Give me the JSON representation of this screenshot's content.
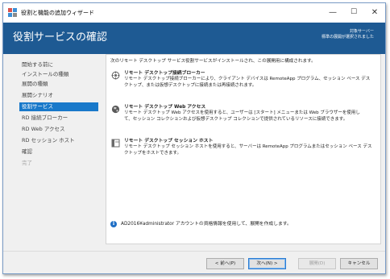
{
  "window": {
    "title": "役割と機能の追加ウィザード",
    "controls": {
      "minimize": "—",
      "maximize": "☐",
      "close": "✕"
    }
  },
  "header": {
    "title": "役割サービスの確認",
    "target_label": "対象サーバー",
    "target_value": "標準の展開が選択されました"
  },
  "nav": {
    "items": [
      {
        "label": "開始する前に",
        "state": "normal"
      },
      {
        "label": "インストールの種類",
        "state": "normal"
      },
      {
        "label": "展開の種類",
        "state": "normal"
      },
      {
        "label": "展開シナリオ",
        "state": "normal"
      },
      {
        "label": "役割サービス",
        "state": "selected"
      },
      {
        "label": "RD 接続ブローカー",
        "state": "normal"
      },
      {
        "label": "RD Web アクセス",
        "state": "normal"
      },
      {
        "label": "RD セッション ホスト",
        "state": "normal"
      },
      {
        "label": "確認",
        "state": "normal"
      },
      {
        "label": "完了",
        "state": "disabled"
      }
    ]
  },
  "content": {
    "intro": "次のリモート デスクトップ サービス役割サービスがインストールされ、この展開用に構成されます。",
    "roles": [
      {
        "title": "リモート デスクトップ接続ブローカー",
        "desc": [
          "リモート デスクトップ接続ブローカーにより、クライアント デバイスは RemoteApp プログラム、セッション ベース デス",
          "クトップ、または仮想デスクトップに接続または再接続されます。"
        ],
        "icon": "broker-icon"
      },
      {
        "title": "リモート デスクトップ Web アクセス",
        "desc": [
          "リモート デスクトップ Web アクセスを使用すると、ユーザーは [スタート] メニューまたは Web ブラウザーを使用し",
          "て、セッション コレクションおよび仮想デスクトップ コレクションで提供されているリソースに接続できます。"
        ],
        "icon": "globe-icon"
      },
      {
        "title": "リモート デスクトップ セッション ホスト",
        "desc": [
          "リモート デスクトップ セッション ホストを使用すると、サーバーは RemoteApp プログラムまたはセッション ベース デス",
          "クトップをホストできます。"
        ],
        "icon": "server-icon"
      }
    ],
    "info": "AD2016¥administrator アカウントの資格情報を使用して、展開を作成します。"
  },
  "buttons": {
    "back": "< 前へ(P)",
    "next": "次へ(N) >",
    "deploy": "展開(D)",
    "cancel": "キャンセル"
  },
  "colors": {
    "header_bg": "#1e5a93",
    "nav_selected": "#1979ca",
    "info_icon": "#1f6fc5"
  }
}
